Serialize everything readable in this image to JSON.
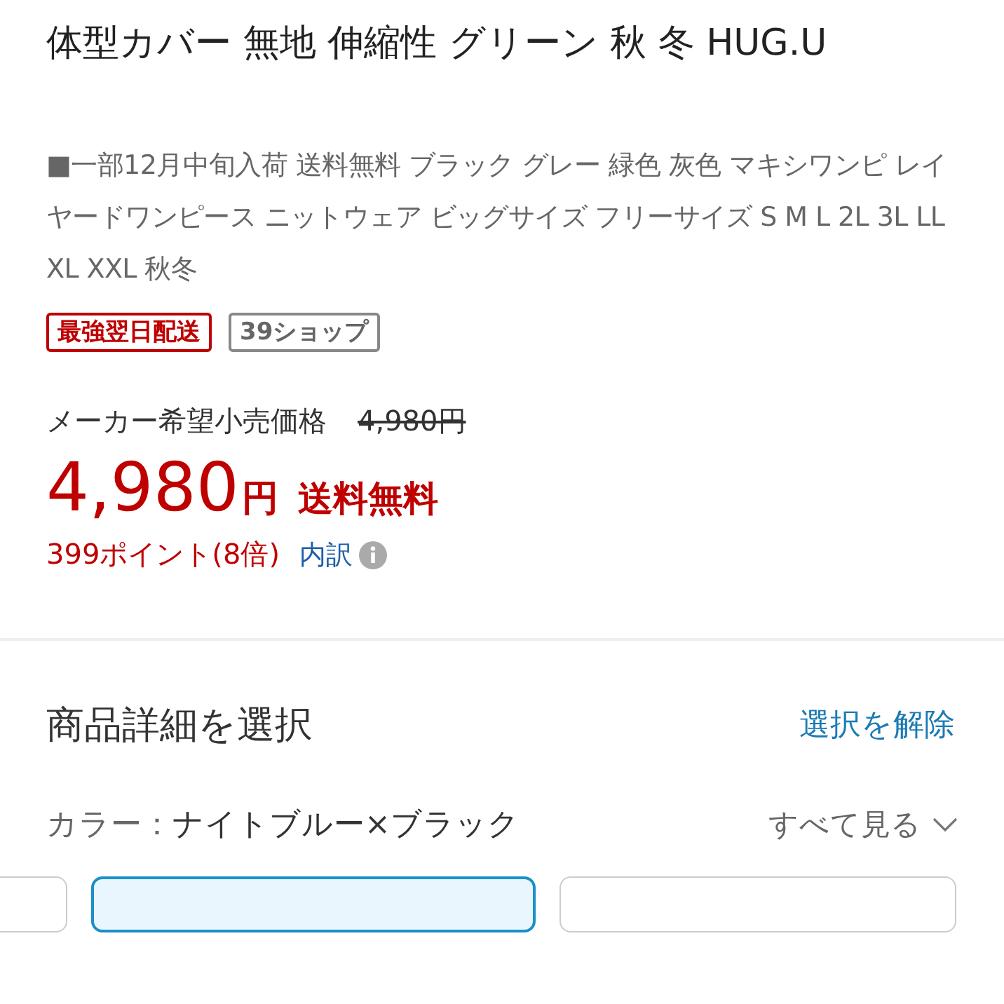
{
  "product": {
    "title": "体型カバー 無地 伸縮性 グリーン 秋 冬 HUG.U",
    "description": "■一部12月中旬入荷 送料無料 ブラック グレー 緑色 灰色 マキシワンピ レイヤードワンピース ニットウェア ビッグサイズ フリーサイズ S M L 2L 3L LL XL XXL 秋冬",
    "badges": [
      {
        "label": "最強翌日配送",
        "kind": "delivery"
      },
      {
        "label": "39ショップ",
        "kind": "shop"
      }
    ]
  },
  "price": {
    "list_label": "メーカー希望小売価格",
    "list_price": "4,980円",
    "amount": "4,980",
    "currency": "円",
    "shipping": "送料無料",
    "points": "399ポイント(8倍)",
    "breakdown_link": "内訳"
  },
  "options": {
    "heading": "商品詳細を選択",
    "clear_link": "選択を解除",
    "color_label": "カラー：",
    "color_value": "ナイトブルー×ブラック",
    "see_all": "すべて見る",
    "cards": [
      {
        "selected": false
      },
      {
        "selected": true
      },
      {
        "selected": false
      }
    ]
  }
}
